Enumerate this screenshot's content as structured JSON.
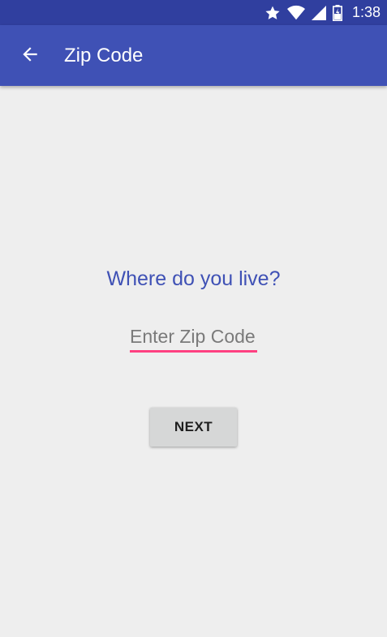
{
  "status_bar": {
    "time": "1:38",
    "icons": [
      "star-icon",
      "wifi-icon",
      "signal-icon",
      "battery-icon"
    ],
    "background": "#303f9f"
  },
  "app_bar": {
    "title": "Zip Code",
    "back_icon": "arrow-back-icon",
    "background": "#3f51b5"
  },
  "content": {
    "prompt": "Where do you live?",
    "zip_input": {
      "value": "",
      "placeholder": "Enter Zip Code",
      "underline_color": "#ff4081"
    },
    "next_label": "NEXT"
  }
}
